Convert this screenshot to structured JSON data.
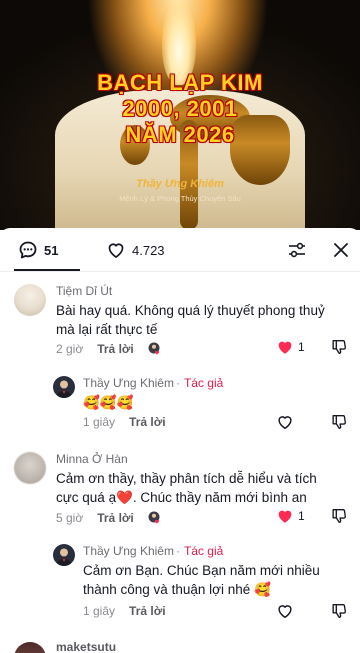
{
  "video": {
    "title_line1": "BẠCH LẠP KIM",
    "title_line2": "2000, 2001",
    "title_line3": "NĂM 2026",
    "author": "Thầy Ưng Khiêm",
    "subtitle": "Mệnh Lý & Phong Thủy Chuyên Sâu"
  },
  "header": {
    "comment_count": "51",
    "like_count": "4.723",
    "icons": [
      "comment-icon",
      "heart-icon",
      "filter-sliders-icon",
      "close-icon"
    ]
  },
  "comments": [
    {
      "username": "Tiệm Dỉ Út",
      "text": "Bài hay quá. Không quá lý thuyết phong thuỷ mà lại rất thực tế",
      "time": "2 giờ",
      "reply_label": "Trả lời",
      "likes": "1",
      "liked": true,
      "reply": {
        "username": "Thầy Ưng Khiêm",
        "author_tag": "Tác giả",
        "text": "🥰🥰🥰",
        "time": "1 giây",
        "reply_label": "Trả lời"
      }
    },
    {
      "username": "Minna Ở Hàn",
      "text": "Cảm ơn thầy, thầy phân tích dễ hiểu và tích cực quá ạ❤️. Chúc thầy năm mới bình an",
      "time": "5 giờ",
      "reply_label": "Trả lời",
      "likes": "1",
      "liked": true,
      "reply": {
        "username": "Thầy Ưng Khiêm",
        "author_tag": "Tác giả",
        "text": "Cảm ơn Bạn. Chúc Bạn năm mới nhiều thành công và thuận lợi nhé 🥰",
        "time": "1 giây",
        "reply_label": "Trả lời"
      }
    },
    {
      "username": "maketsutu"
    }
  ],
  "colors": {
    "like_red": "#fe2c55",
    "author_tag": "#e21d4c",
    "title_yellow": "#ffd21f"
  }
}
